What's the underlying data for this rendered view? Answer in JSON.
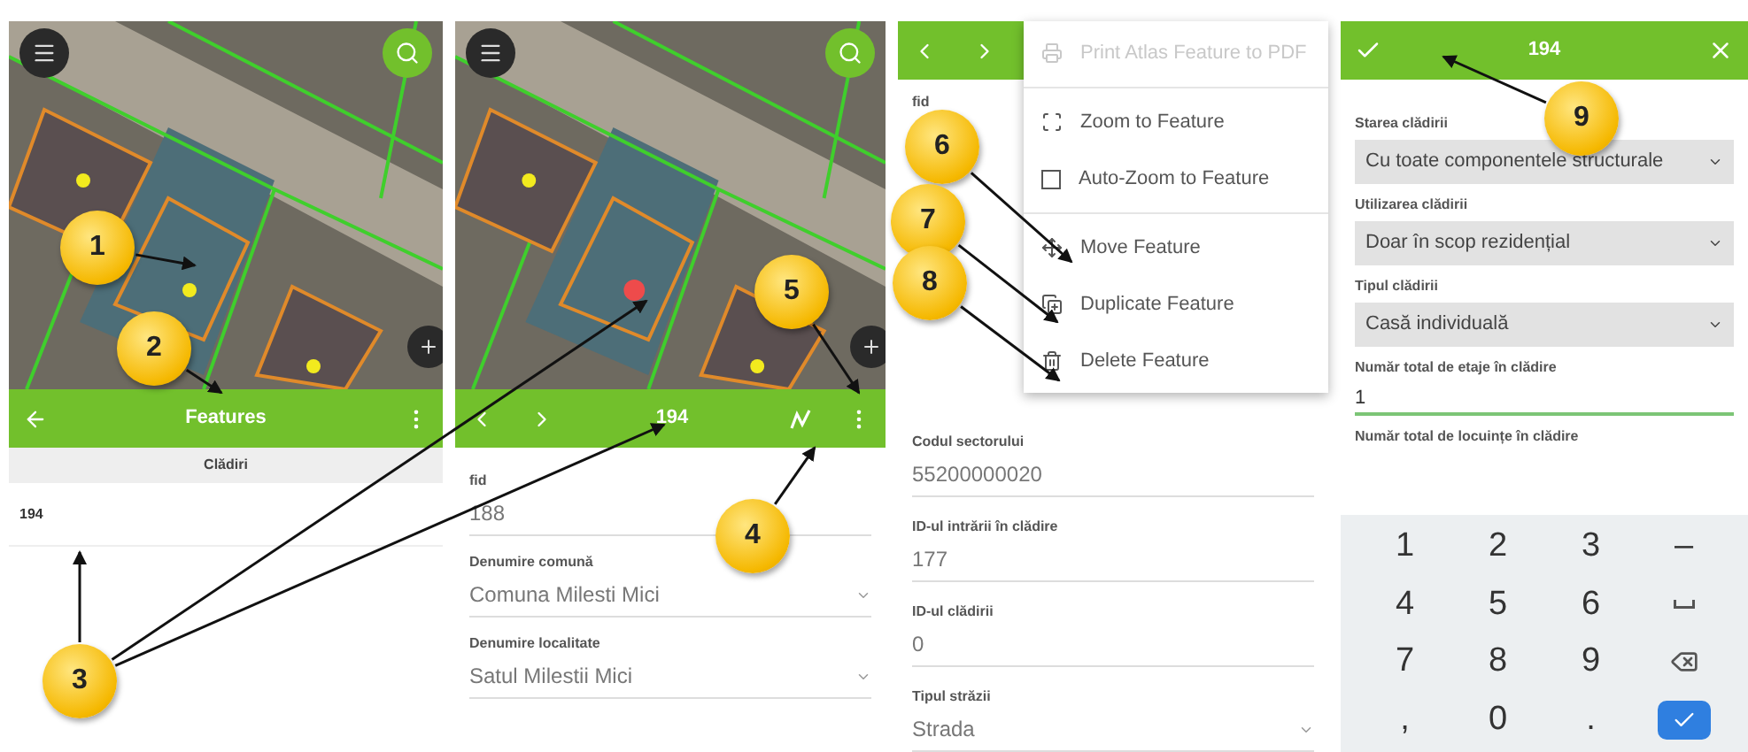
{
  "features_screen": {
    "title": "Features",
    "layer_header": "Clădiri",
    "items": [
      {
        "label": "194",
        "selected": false
      }
    ]
  },
  "feature_form": {
    "title": "194",
    "fields": [
      {
        "label": "fid",
        "value": "188",
        "kind": "text"
      },
      {
        "label": "Denumire comună",
        "value": "Comuna Milesti Mici",
        "kind": "dropdown"
      },
      {
        "label": "Denumire localitate",
        "value": "Satul Milestii Mici",
        "kind": "dropdown"
      }
    ]
  },
  "menu_screen": {
    "top_field_label": "fid",
    "fields": [
      {
        "label": "Codul sectorului",
        "value": "55200000020",
        "kind": "text"
      },
      {
        "label": "ID-ul intrării în clădire",
        "value": "177",
        "kind": "text"
      },
      {
        "label": "ID-ul clădirii",
        "value": "0",
        "kind": "text"
      },
      {
        "label": "Tipul străzii",
        "value": "Strada",
        "kind": "dropdown"
      }
    ],
    "menu": [
      {
        "label": "Print Atlas Feature to PDF",
        "kind": "print",
        "disabled": true
      },
      {
        "label": "Zoom to Feature",
        "kind": "zoom",
        "disabled": false
      },
      {
        "label": "Auto-Zoom to Feature",
        "kind": "checkbox",
        "disabled": false,
        "checked": false
      },
      {
        "label": "Move Feature",
        "kind": "move",
        "disabled": false
      },
      {
        "label": "Duplicate Feature",
        "kind": "duplicate",
        "disabled": false
      },
      {
        "label": "Delete Feature",
        "kind": "delete",
        "disabled": false
      }
    ]
  },
  "edit_screen": {
    "title": "194",
    "fields": [
      {
        "label": "Starea clădirii",
        "value": "Cu toate componentele structurale",
        "kind": "dropdown"
      },
      {
        "label": "Utilizarea clădirii",
        "value": "Doar în scop rezidențial",
        "kind": "dropdown"
      },
      {
        "label": "Tipul clădirii",
        "value": "Casă individuală",
        "kind": "dropdown"
      },
      {
        "label": "Număr total de etaje în clădire",
        "value": "1",
        "kind": "input"
      },
      {
        "label": "Număr total de locuințe în clădire",
        "kind": "label"
      }
    ],
    "keypad": [
      {
        "kind": "char",
        "label": "1"
      },
      {
        "kind": "char",
        "label": "2"
      },
      {
        "kind": "char",
        "label": "3"
      },
      {
        "kind": "char",
        "label": "–"
      },
      {
        "kind": "char",
        "label": "4"
      },
      {
        "kind": "char",
        "label": "5"
      },
      {
        "kind": "char",
        "label": "6"
      },
      {
        "kind": "space"
      },
      {
        "kind": "char",
        "label": "7"
      },
      {
        "kind": "char",
        "label": "8"
      },
      {
        "kind": "char",
        "label": "9"
      },
      {
        "kind": "backspace"
      },
      {
        "kind": "char",
        "label": ","
      },
      {
        "kind": "char",
        "label": "0"
      },
      {
        "kind": "char",
        "label": "."
      },
      {
        "kind": "done"
      }
    ]
  },
  "callouts": [
    {
      "label": "1"
    },
    {
      "label": "2"
    },
    {
      "label": "3"
    },
    {
      "label": "4"
    },
    {
      "label": "5"
    },
    {
      "label": "6"
    },
    {
      "label": "7"
    },
    {
      "label": "8"
    },
    {
      "label": "9"
    }
  ]
}
